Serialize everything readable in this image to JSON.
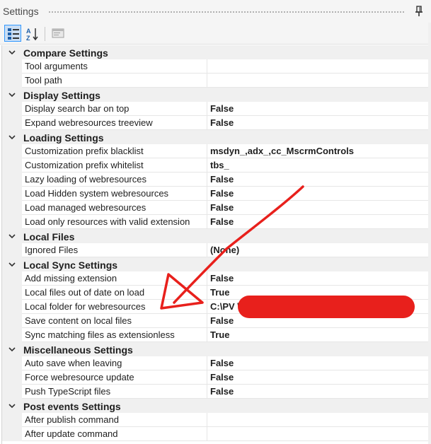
{
  "window": {
    "title": "Settings"
  },
  "toolbar": {
    "buttons": [
      {
        "icon": "categorized-icon",
        "active": true
      },
      {
        "icon": "alphabetical-sort-icon",
        "active": false
      },
      {
        "icon": "property-pages-icon",
        "active": false
      }
    ]
  },
  "grid": {
    "categories": [
      {
        "name": "Compare Settings",
        "props": [
          {
            "name": "Tool arguments",
            "value": ""
          },
          {
            "name": "Tool path",
            "value": ""
          }
        ]
      },
      {
        "name": "Display Settings",
        "props": [
          {
            "name": "Display search bar on top",
            "value": "False"
          },
          {
            "name": "Expand webresources treeview",
            "value": "False"
          }
        ]
      },
      {
        "name": "Loading Settings",
        "props": [
          {
            "name": "Customization prefix blacklist",
            "value": "msdyn_,adx_,cc_MscrmControls"
          },
          {
            "name": "Customization prefix whitelist",
            "value": "tbs_"
          },
          {
            "name": "Lazy loading of webresources",
            "value": "False"
          },
          {
            "name": "Load Hidden system webresources",
            "value": "False"
          },
          {
            "name": "Load managed webresources",
            "value": "False"
          },
          {
            "name": "Load only resources with valid extension",
            "value": "False"
          }
        ]
      },
      {
        "name": "Local Files",
        "props": [
          {
            "name": "Ignored Files",
            "value": "(None)"
          }
        ]
      },
      {
        "name": "Local Sync Settings",
        "props": [
          {
            "name": "Add missing extension",
            "value": "False"
          },
          {
            "name": "Local files out of date on load",
            "value": "True"
          },
          {
            "name": "Local folder for webresources",
            "value": "C:\\PV                                                   \\Wa"
          },
          {
            "name": "Save content on local files",
            "value": "False"
          },
          {
            "name": "Sync matching files as extensionless",
            "value": "True"
          }
        ]
      },
      {
        "name": "Miscellaneous Settings",
        "props": [
          {
            "name": "Auto save when leaving",
            "value": "False"
          },
          {
            "name": "Force webresource update",
            "value": "False"
          },
          {
            "name": "Push TypeScript files",
            "value": "False"
          }
        ]
      },
      {
        "name": "Post events Settings",
        "props": [
          {
            "name": "After publish command",
            "value": ""
          },
          {
            "name": "After update command",
            "value": ""
          }
        ]
      }
    ]
  },
  "colors": {
    "category_bg": "#f0f0f0",
    "annotation_red": "#e8201c",
    "selected_button": "#c9def5"
  }
}
